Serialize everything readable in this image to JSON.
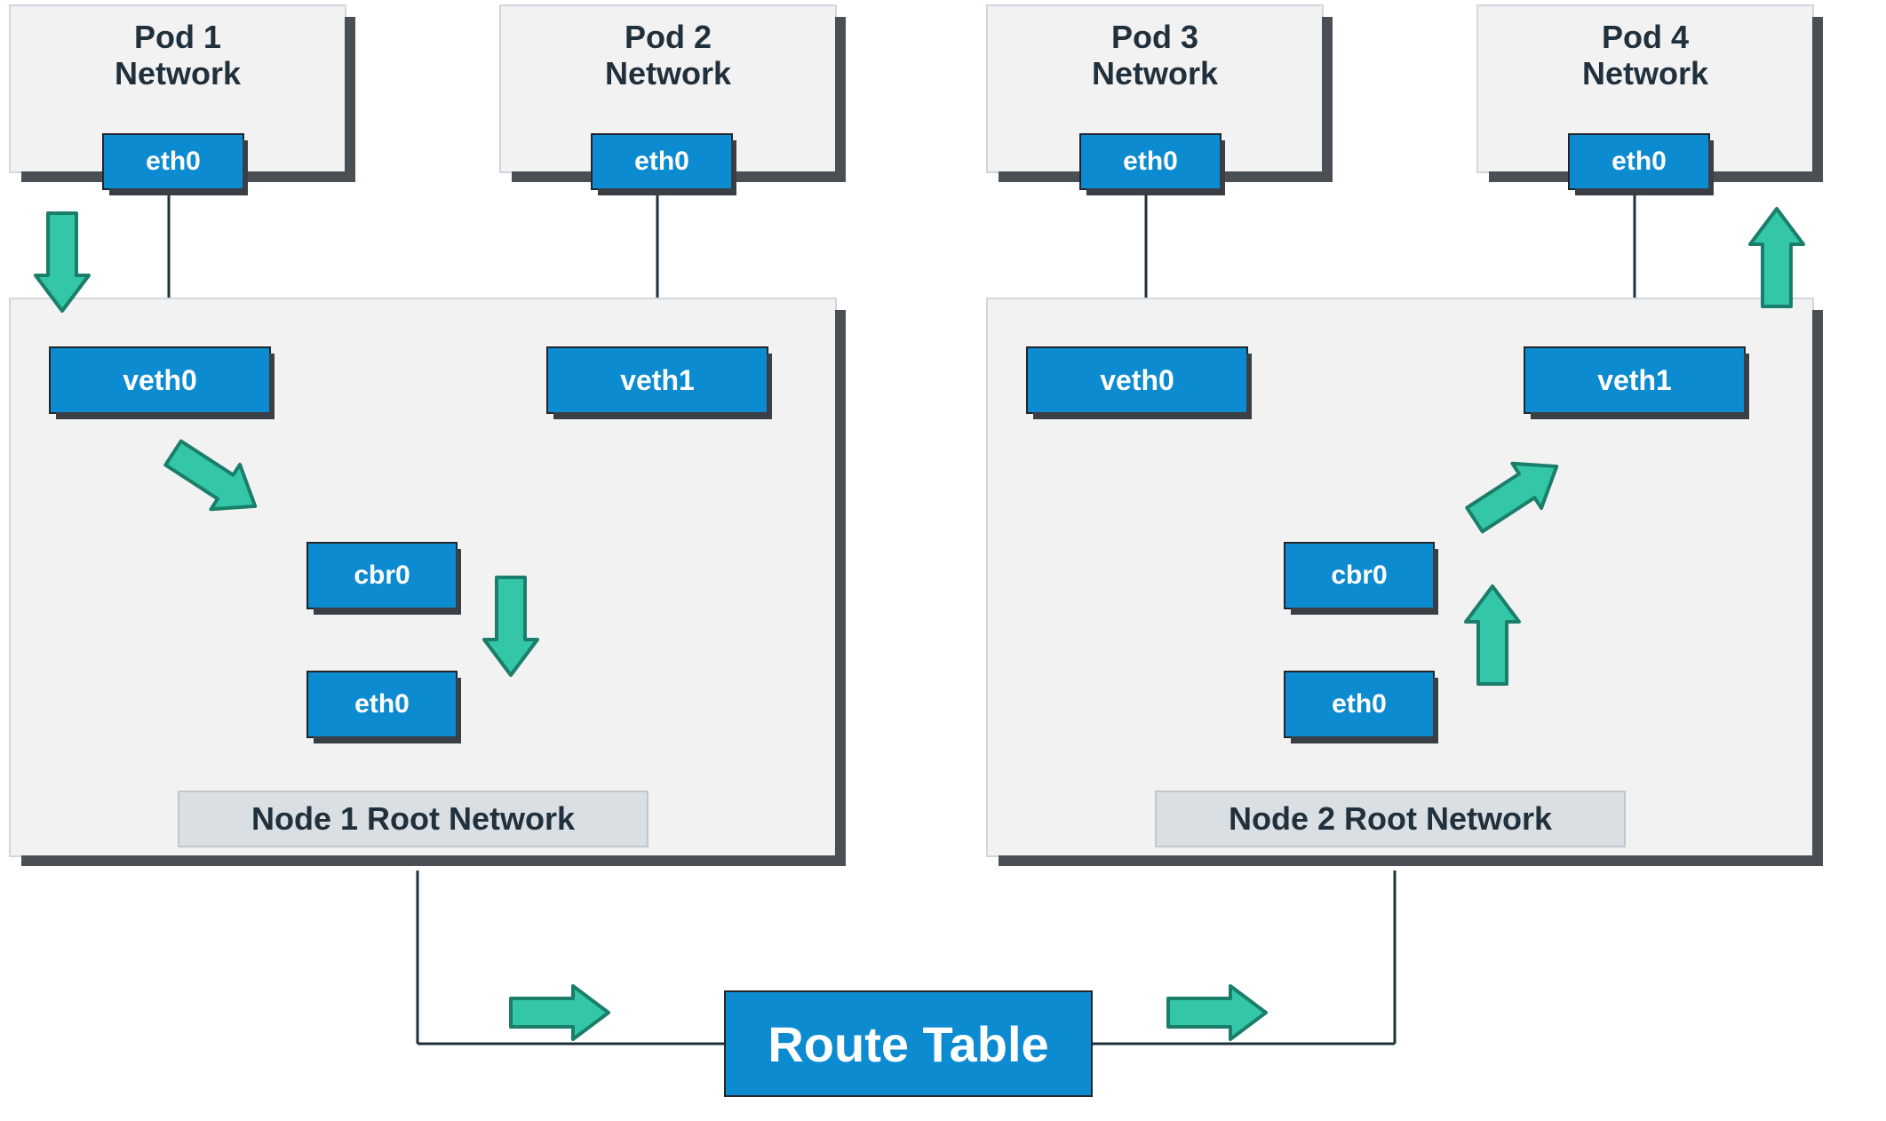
{
  "pods": {
    "pod1": {
      "title_l1": "Pod 1",
      "title_l2": "Network",
      "eth": "eth0"
    },
    "pod2": {
      "title_l1": "Pod 2",
      "title_l2": "Network",
      "eth": "eth0"
    },
    "pod3": {
      "title_l1": "Pod 3",
      "title_l2": "Network",
      "eth": "eth0"
    },
    "pod4": {
      "title_l1": "Pod 4",
      "title_l2": "Network",
      "eth": "eth0"
    }
  },
  "node1": {
    "veth0": "veth0",
    "veth1": "veth1",
    "cbr": "cbr0",
    "eth": "eth0",
    "label": "Node 1 Root Network"
  },
  "node2": {
    "veth0": "veth0",
    "veth1": "veth1",
    "cbr": "cbr0",
    "eth": "eth0",
    "label": "Node 2 Root Network"
  },
  "route_table": "Route Table",
  "colors": {
    "chip": "#0d8bd1",
    "panel": "#f2f2f2",
    "shadow": "#4a4f55",
    "arrow_fill": "#33c7a7",
    "arrow_stroke": "#1a7e6a",
    "text_dark": "#20303c"
  }
}
